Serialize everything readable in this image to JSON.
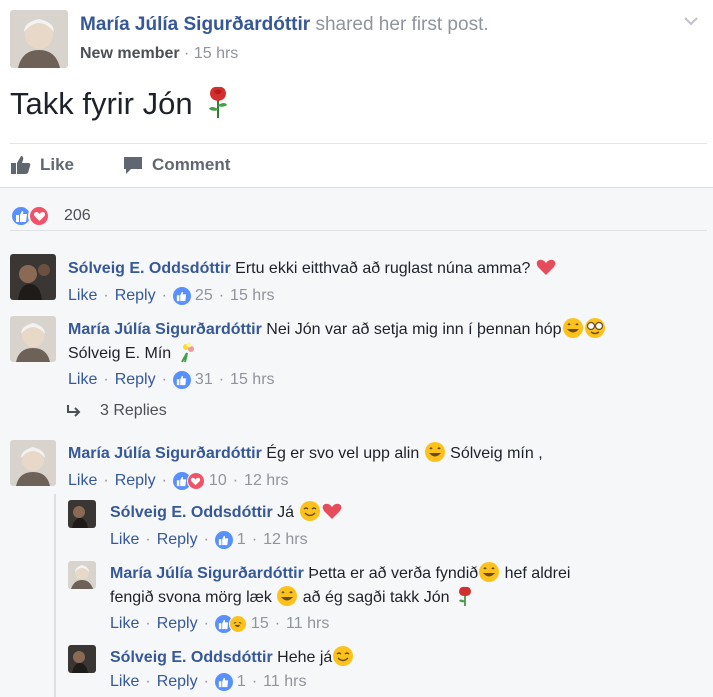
{
  "post": {
    "author": "María Júlía Sigurðardóttir",
    "action": "shared her first post.",
    "role": "New member",
    "time": "15 hrs",
    "text": "Takk fyrir Jón",
    "like_label": "Like",
    "comment_label": "Comment"
  },
  "reactions": {
    "count": "206"
  },
  "comments": [
    {
      "author": "Sólveig E. Oddsdóttir",
      "text": "Ertu ekki eitthvað að ruglast núna amma?",
      "like": "Like",
      "reply": "Reply",
      "likes": "25",
      "time": "15 hrs"
    },
    {
      "author": "María Júlía Sigurðardóttir",
      "text": "Nei Jón var að setja mig inn í þennan hóp",
      "text2": "Sólveig E. Mín",
      "like": "Like",
      "reply": "Reply",
      "likes": "31",
      "time": "15 hrs",
      "replies_label": "3 Replies"
    },
    {
      "author": "María Júlía Sigurðardóttir",
      "text": "Ég er svo vel upp alin",
      "text_after": "Sólveig mín ,",
      "like": "Like",
      "reply": "Reply",
      "likes": "10",
      "time": "12 hrs"
    }
  ],
  "replies": [
    {
      "author": "Sólveig E. Oddsdóttir",
      "text": "Já",
      "like": "Like",
      "reply": "Reply",
      "likes": "1",
      "time": "12 hrs"
    },
    {
      "author": "María Júlía Sigurðardóttir",
      "text": "Þetta er að verða fyndið",
      "text_after": "hef aldrei",
      "text2": "fengið svona mörg læk",
      "text2_after": "að ég sagði takk Jón",
      "like": "Like",
      "reply": "Reply",
      "likes": "15",
      "time": "11 hrs"
    },
    {
      "author": "Sólveig E. Oddsdóttir",
      "text": "Hehe já",
      "like": "Like",
      "reply": "Reply",
      "likes": "1",
      "time": "11 hrs"
    }
  ],
  "colors": {
    "link": "#365899",
    "meta": "#90949c",
    "like_blue": "#5890ff",
    "love_red": "#f25268"
  }
}
